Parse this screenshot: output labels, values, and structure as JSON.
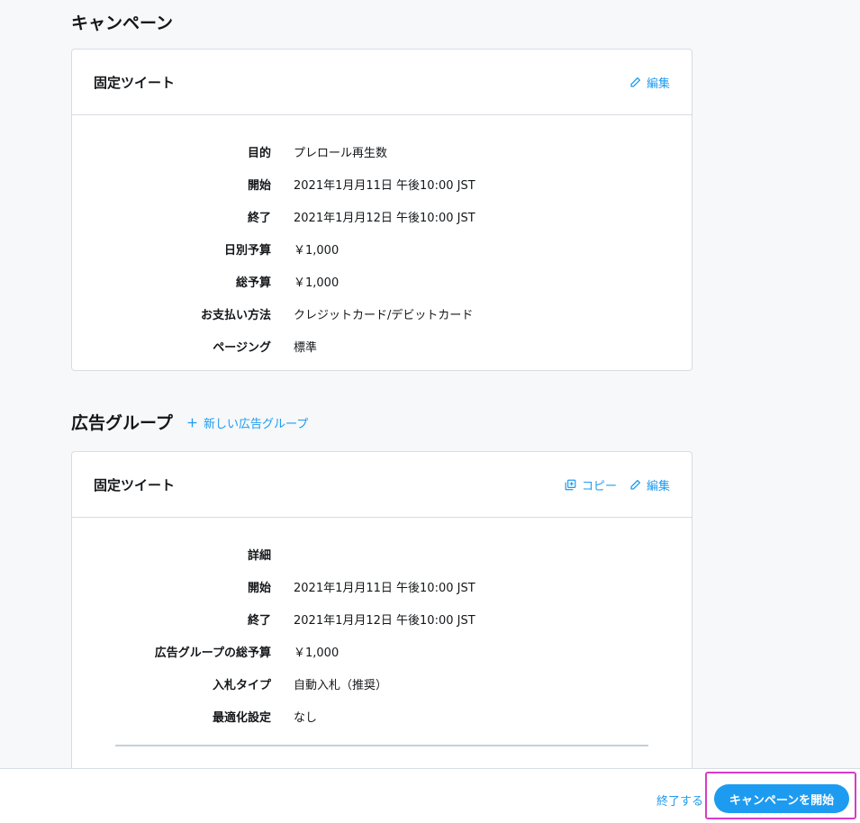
{
  "campaign": {
    "section_title": "キャンペーン",
    "card_title": "固定ツイート",
    "edit_label": "編集",
    "rows": [
      {
        "label": "目的",
        "value": "プレロール再生数"
      },
      {
        "label": "開始",
        "value": "2021年1月月11日 午後10:00 JST"
      },
      {
        "label": "終了",
        "value": "2021年1月月12日 午後10:00 JST"
      },
      {
        "label": "日別予算",
        "value": "￥1,000"
      },
      {
        "label": "総予算",
        "value": "￥1,000"
      },
      {
        "label": "お支払い方法",
        "value": "クレジットカード/デビットカード"
      },
      {
        "label": "ページング",
        "value": "標準"
      }
    ]
  },
  "ad_group": {
    "section_title": "広告グループ",
    "new_group_label": "新しい広告グループ",
    "card_title": "固定ツイート",
    "copy_label": "コピー",
    "edit_label": "編集",
    "rows": [
      {
        "label": "詳細",
        "value": ""
      },
      {
        "label": "開始",
        "value": "2021年1月月11日 午後10:00 JST"
      },
      {
        "label": "終了",
        "value": "2021年1月月12日 午後10:00 JST"
      },
      {
        "label": "広告グループの総予算",
        "value": "￥1,000"
      },
      {
        "label": "入札タイプ",
        "value": "自動入札（推奨）"
      },
      {
        "label": "最適化設定",
        "value": "なし"
      }
    ]
  },
  "footer": {
    "end_label": "終了する",
    "start_label": "キャンペーンを開始"
  },
  "colors": {
    "accent": "#1d9bf0",
    "highlight": "#d63cc6",
    "background": "#f6f8fa"
  },
  "icons": {
    "edit": "pencil-icon",
    "add": "plus-icon",
    "copy": "copy-icon"
  }
}
